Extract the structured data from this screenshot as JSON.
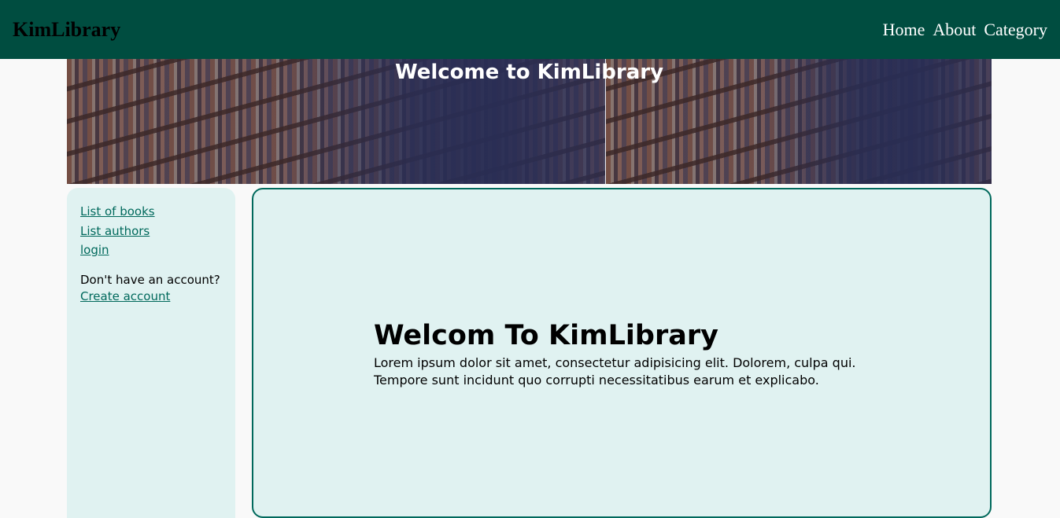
{
  "header": {
    "brand": "KimLibrary",
    "nav": [
      "Home",
      "About",
      "Category"
    ]
  },
  "hero": {
    "title": "Welcome to KimLibrary"
  },
  "sidebar": {
    "links": [
      "List of books",
      "List authors",
      "login"
    ],
    "account_prompt": "Don't have an account?",
    "create_account": "Create account"
  },
  "main": {
    "title": "Welcom To KimLibrary",
    "body": "Lorem ipsum dolor sit amet, consectetur adipisicing elit. Dolorem, culpa qui. Tempore sunt incidunt quo corrupti necessitatibus earum et explicabo."
  },
  "colors": {
    "header_bg": "#004d40",
    "panel_bg": "#e0f2f1",
    "link": "#00695c",
    "border": "#00695c"
  }
}
